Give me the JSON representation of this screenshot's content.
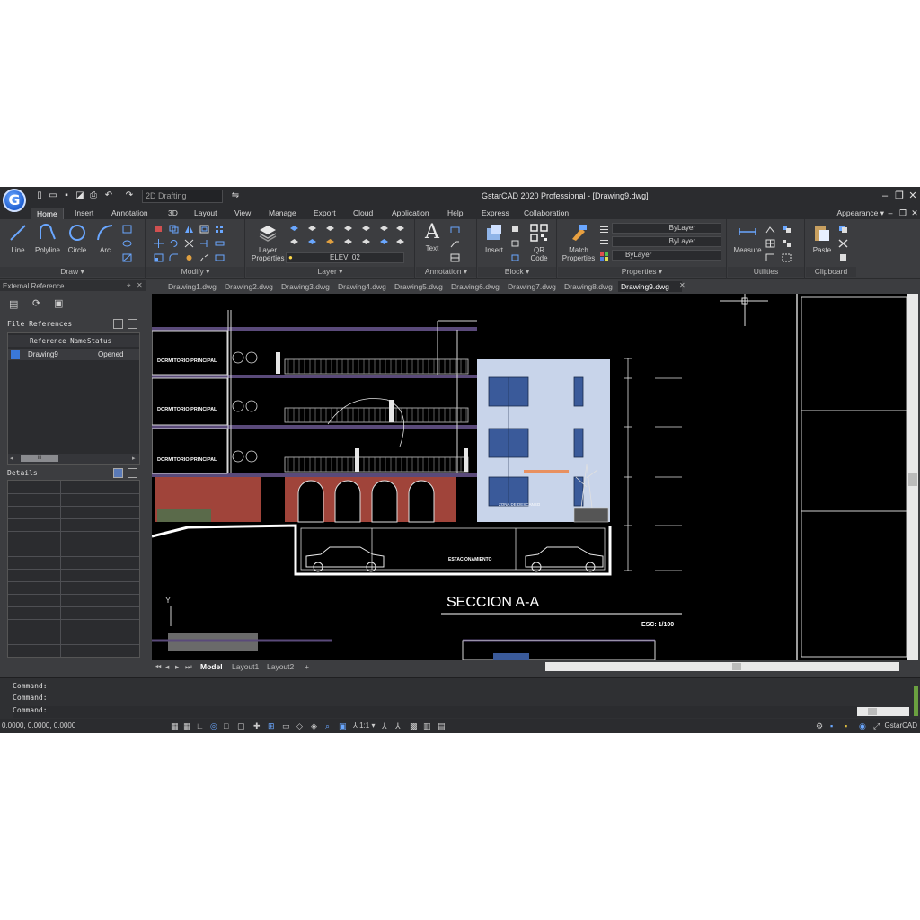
{
  "app": {
    "title": "GstarCAD 2020 Professional - [Drawing9.dwg]",
    "logo_letter": "G",
    "workspace": "2D Drafting"
  },
  "menu_tabs": [
    "Home",
    "Insert",
    "Annotation",
    "3D",
    "Layout",
    "View",
    "Manage",
    "Export",
    "Cloud",
    "Application",
    "Help",
    "Express",
    "Collaboration"
  ],
  "active_menu_tab": "Home",
  "appearance_label": "Appearance",
  "ribbon": {
    "draw": {
      "label": "Draw",
      "buttons": [
        "Line",
        "Polyline",
        "Circle",
        "Arc"
      ]
    },
    "modify": {
      "label": "Modify"
    },
    "layer": {
      "label": "Layer",
      "properties_label": "Layer Properties",
      "current_layer": "ELEV_02"
    },
    "annotation": {
      "label": "Annotation",
      "text_label": "Text"
    },
    "block": {
      "label": "Block",
      "insert_label": "Insert",
      "qr_label": "QR Code"
    },
    "properties": {
      "label": "Properties",
      "match_label": "Match Properties",
      "bylayer_1": "ByLayer",
      "bylayer_2": "ByLayer",
      "bylayer_3": "ByLayer"
    },
    "utilities": {
      "label": "Utilities",
      "measure_label": "Measure"
    },
    "clipboard": {
      "label": "Clipboard",
      "paste_label": "Paste"
    }
  },
  "palette": {
    "title": "External Reference",
    "file_refs_label": "File References",
    "col_ref_name": "Reference Name",
    "col_status": "Status",
    "row_name": "Drawing9",
    "row_status": "Opened",
    "details_label": "Details",
    "scroll_grip": "III"
  },
  "doc_tabs": [
    "Drawing1.dwg",
    "Drawing2.dwg",
    "Drawing3.dwg",
    "Drawing4.dwg",
    "Drawing5.dwg",
    "Drawing6.dwg",
    "Drawing7.dwg",
    "Drawing8.dwg",
    "Drawing9.dwg"
  ],
  "active_doc_tab": "Drawing9.dwg",
  "drawing": {
    "section_title": "SECCION A-A",
    "scale": "ESC: 1/100",
    "room_1": "DORMITORIO PRINCIPAL",
    "room_2": "DORMITORIO PRINCIPAL",
    "room_3": "DORMITORIO PRINCIPAL",
    "parking": "ESTACIONAMIENTO",
    "rest_zone": "ZONA DE DESCANSO",
    "axis_y": "Y"
  },
  "layout_tabs": [
    "Model",
    "Layout1",
    "Layout2"
  ],
  "command": {
    "line1": "Command:",
    "line2": "Command:",
    "line3": "Command:"
  },
  "status": {
    "coords": "0.0000, 0.0000, 0.0000",
    "brand": "GstarCAD",
    "scale": "1:1"
  },
  "colors": {
    "background": "#000000",
    "chrome": "#3c3d40",
    "floor_slab": "#5a4a7a",
    "brick": "#a0443a",
    "facade": "#c8d4ea",
    "window": "#3a5a9a"
  }
}
